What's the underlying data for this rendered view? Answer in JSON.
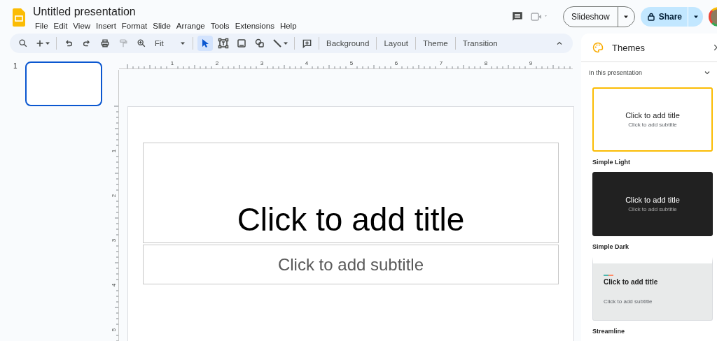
{
  "app": {
    "title": "Untitled presentation",
    "menu": [
      "File",
      "Edit",
      "View",
      "Insert",
      "Format",
      "Slide",
      "Arrange",
      "Tools",
      "Extensions",
      "Help"
    ]
  },
  "header_actions": {
    "slideshow": "Slideshow",
    "share": "Share"
  },
  "toolbar": {
    "zoom": "Fit",
    "paint_format": {
      "disabled": true
    },
    "tools": [
      {
        "kind": "select",
        "selected": true
      },
      {
        "kind": "textbox",
        "selected": false
      },
      {
        "kind": "image",
        "selected": false
      },
      {
        "kind": "shape",
        "selected": false
      },
      {
        "kind": "line",
        "selected": false
      }
    ],
    "buttons": [
      "Background",
      "Layout",
      "Theme",
      "Transition"
    ]
  },
  "filmstrip": {
    "slides": [
      {
        "number": "1",
        "selected": true
      }
    ]
  },
  "rulers": {
    "horizontal": [
      "1",
      "2",
      "3",
      "4",
      "5",
      "6",
      "7",
      "8",
      "9"
    ],
    "vertical": [
      "1",
      "2",
      "3",
      "4",
      "5"
    ]
  },
  "slide": {
    "title": "Click to add title",
    "subtitle": "Click to add subtitle"
  },
  "themes_panel": {
    "title": "Themes",
    "section": "In this presentation",
    "themes": [
      {
        "kind": "light",
        "name": "Simple Light",
        "selected": true,
        "title": "Click to add title",
        "subtitle": "Click to add subtitle"
      },
      {
        "kind": "dark",
        "name": "Simple Dark",
        "selected": false,
        "title": "Click to add title",
        "subtitle": "Click to add subtitle"
      },
      {
        "kind": "streamline",
        "name": "Streamline",
        "selected": false,
        "title": "Click to add title",
        "subtitle": "Click to add subtitle"
      }
    ]
  }
}
